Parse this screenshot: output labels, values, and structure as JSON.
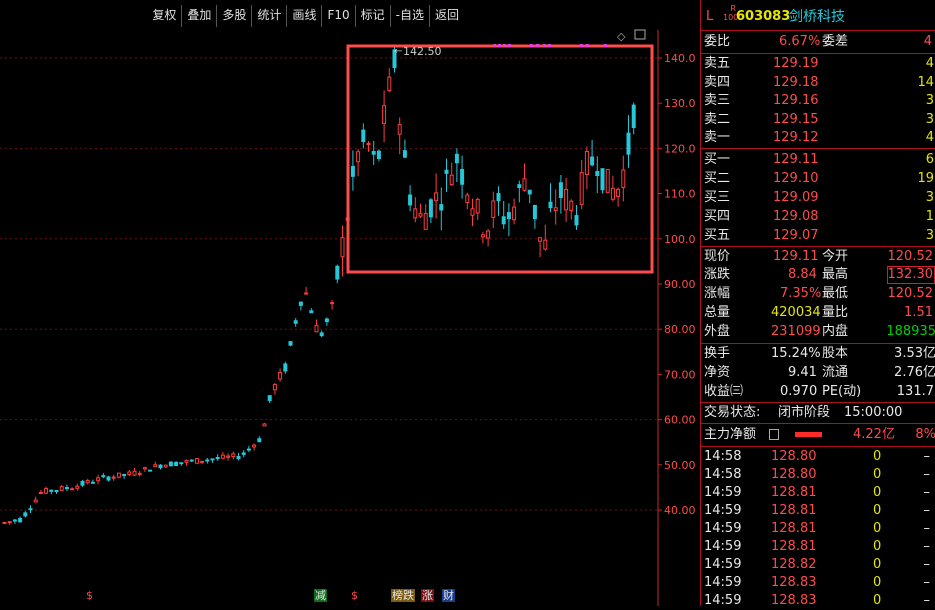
{
  "toolbar": {
    "buttons": [
      "复权",
      "叠加",
      "多股",
      "统计",
      "画线",
      "F10",
      "标记",
      "-自选",
      "返回"
    ]
  },
  "chart": {
    "price_ticks": [
      "140.0",
      "130.0",
      "120.0",
      "110.0",
      "100.0",
      "90.00",
      "80.00",
      "70.00",
      "60.00",
      "50.00",
      "40.00"
    ],
    "high_marker": "142.50",
    "bottom_tags": [
      "$",
      "减",
      "$",
      "榜跌",
      "涨",
      "财"
    ],
    "colors": {
      "up": "#ff3c3c",
      "down": "#25c7d8",
      "grid": "#6a0f14",
      "axis": "#c82828",
      "highlight": "#ff4d4d"
    }
  },
  "header": {
    "prefix": "L",
    "badge_top": "R",
    "badge_bottom": "1000",
    "code": "603083",
    "name": "剑桥科技"
  },
  "weibi": {
    "label": "委比",
    "value": "6.67%",
    "label2": "委差",
    "value2": "4"
  },
  "asks": [
    {
      "label": "卖五",
      "price": "129.19",
      "vol": "4"
    },
    {
      "label": "卖四",
      "price": "129.18",
      "vol": "14"
    },
    {
      "label": "卖三",
      "price": "129.16",
      "vol": "3"
    },
    {
      "label": "卖二",
      "price": "129.15",
      "vol": "3"
    },
    {
      "label": "卖一",
      "price": "129.12",
      "vol": "4"
    }
  ],
  "bids": [
    {
      "label": "买一",
      "price": "129.11",
      "vol": "6"
    },
    {
      "label": "买二",
      "price": "129.10",
      "vol": "19"
    },
    {
      "label": "买三",
      "price": "129.09",
      "vol": "3"
    },
    {
      "label": "买四",
      "price": "129.08",
      "vol": "1"
    },
    {
      "label": "买五",
      "price": "129.07",
      "vol": "3"
    }
  ],
  "quote": {
    "xianjia_label": "现价",
    "xianjia": "129.11",
    "jinkai_label": "今开",
    "jinkai": "120.52",
    "zhangdie_label": "涨跌",
    "zhangdie": "8.84",
    "zuigao_label": "最高",
    "zuigao": "132.30",
    "zhangfu_label": "涨幅",
    "zhangfu": "7.35%",
    "zuidi_label": "最低",
    "zuidi": "120.52",
    "zongliang_label": "总量",
    "zongliang": "420034",
    "liangbi_label": "量比",
    "liangbi": "1.51",
    "waipan_label": "外盘",
    "waipan": "231099",
    "neipan_label": "内盘",
    "neipan": "188935",
    "huanshou_label": "换手",
    "huanshou": "15.24%",
    "guben_label": "股本",
    "guben": "3.53亿",
    "jingzi_label": "净资",
    "jingzi": "9.41",
    "liutong_label": "流通",
    "liutong": "2.76亿",
    "shouyi_label": "收益㈢",
    "shouyi": "0.970",
    "pe_label": "PE(动)",
    "pe": "131.7"
  },
  "status": {
    "label": "交易状态:",
    "value": "闭市阶段",
    "time": "15:00:00"
  },
  "zhuli": {
    "label": "主力净额",
    "value": "4.22亿",
    "pct": "8%"
  },
  "ticks": [
    {
      "time": "14:58",
      "price": "128.80",
      "vol": "0",
      "dir": "–"
    },
    {
      "time": "14:58",
      "price": "128.80",
      "vol": "0",
      "dir": "–"
    },
    {
      "time": "14:59",
      "price": "128.81",
      "vol": "0",
      "dir": "–"
    },
    {
      "time": "14:59",
      "price": "128.81",
      "vol": "0",
      "dir": "–"
    },
    {
      "time": "14:59",
      "price": "128.81",
      "vol": "0",
      "dir": "–"
    },
    {
      "time": "14:59",
      "price": "128.81",
      "vol": "0",
      "dir": "–"
    },
    {
      "time": "14:59",
      "price": "128.82",
      "vol": "0",
      "dir": "–"
    },
    {
      "time": "14:59",
      "price": "128.83",
      "vol": "0",
      "dir": "–"
    },
    {
      "time": "14:59",
      "price": "128.83",
      "vol": "0",
      "dir": "–"
    }
  ]
}
